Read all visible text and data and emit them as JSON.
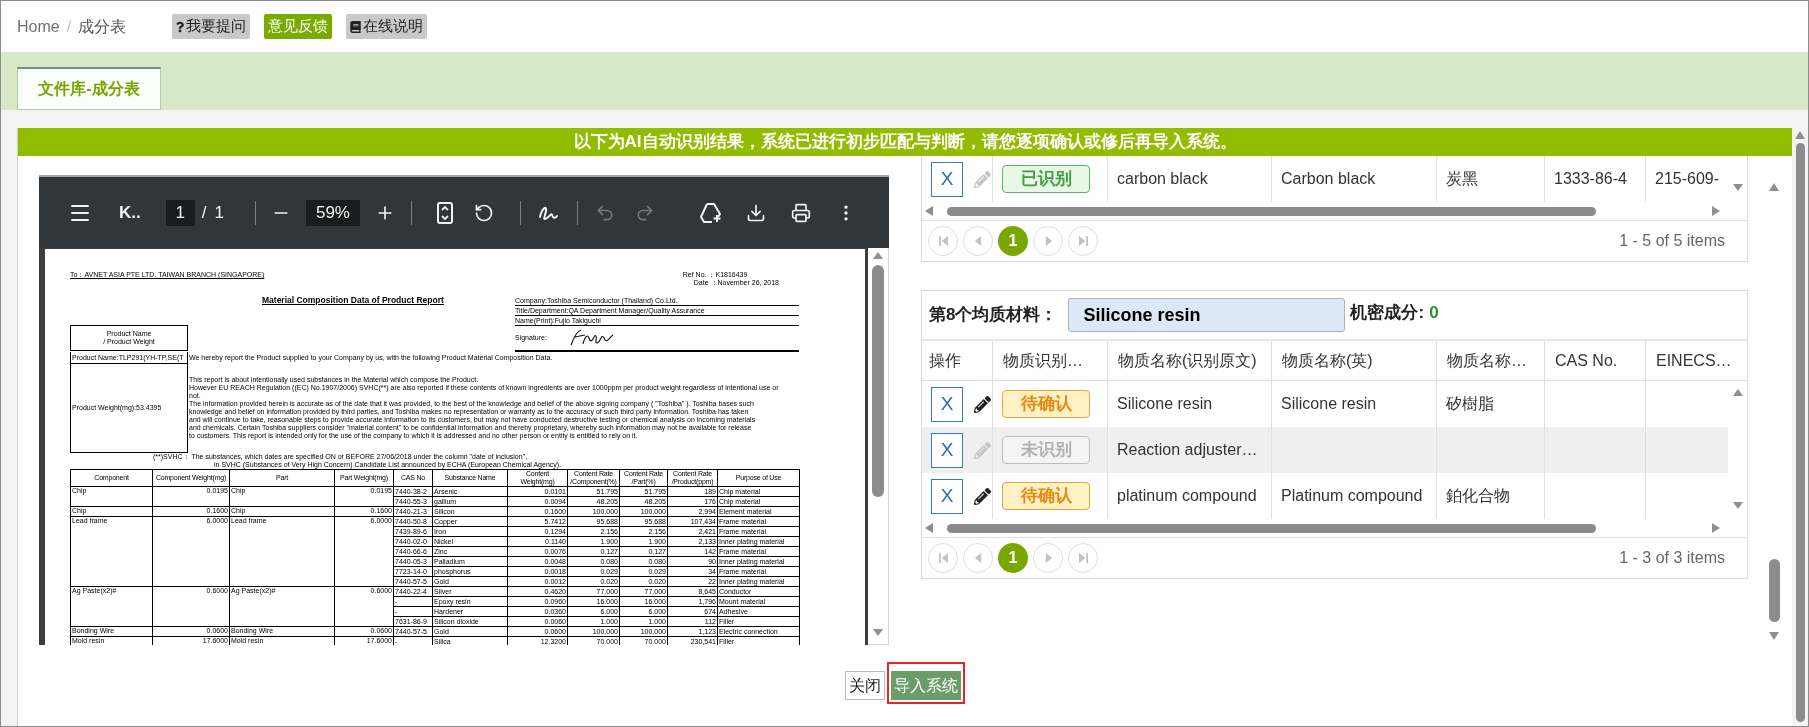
{
  "header": {
    "breadcrumb": [
      "Home",
      "成分表"
    ],
    "separator": "/",
    "buttons": [
      {
        "label": "我要提问",
        "kind": "help"
      },
      {
        "label": "意见反馈",
        "kind": "feedback"
      },
      {
        "label": "在线说明",
        "kind": "manual"
      }
    ]
  },
  "tabs": [
    {
      "label": "文件库-成分表",
      "selected": true
    }
  ],
  "banner": "以下为AI自动识别结果，系统已进行初步匹配与判断，请您逐项确认或修后再导入系统。",
  "pdf_viewer": {
    "toolbar": {
      "title": "K..",
      "page": "1",
      "page_separator": "/",
      "page_total": "1",
      "zoom": "59%",
      "undo_disabled": true,
      "redo_disabled": true
    },
    "document": {
      "recipient": "To：AVNET ASIA PTE LTD. TAIWAN BRANCH (SINGAPORE)",
      "ref_no": "Ref No. ：K1816439",
      "date": "Date ：November 26, 2018",
      "title": "Material Composition Data of Product Report",
      "signer_fields": [
        "Company:Toshiba Semiconductor (Thailand) Co.Ltd.",
        "Title/Department:QA Department Manager/Quality Assurance",
        "Name(Print):Fujio Takiguchi"
      ],
      "signature_label": "Signature:",
      "product_heading": [
        "Product Name",
        "/ Product Weight"
      ],
      "product_name": "Product Name:TLP291(YH-TP,SE(T",
      "product_weight": "Product Weight(mg):53.4395",
      "intro": "We hereby report the Product supplied to your Company by us, with the following Product Material Composition Data.",
      "notice_lines": [
        "This report is about intentionally used substances in the Material which compose the Product.",
        "However EU REACH Regulation ((EC) No.1907/2006) SVHC(**) are also reported if these contents of known ingredients are over 1000ppm per product weight regardless of intentional use or",
        "not.",
        "The information provided herein is accurate as of the date that it was provided, to the best of the knowledge and belief of the above signing company ( \"Toshiba\" ). Toshiba bases such",
        "knowledge and belief on information provided by third parties, and Toshiba makes no representation or warranty as to the accuracy of such third party information. Toshiba has taken",
        "and will continue to take, reasonable steps to provide accurate information to its customers, but may not have conducted destructive testing or chemical analysis on incoming materials",
        "and chemicals. Certain Toshiba suppliers consider \"material content\" to be confidential information and thereby proprietary, whereby such information may not be available for release",
        "to customers. This report is intended only for the use of the company to which it is addressed and no other person or entity is entitled to rely on it."
      ],
      "svhc_lines": [
        "(**)SVHC： The substances, which dates are specified ON or BEFORE 27/06/2018 under the column \"date of inclusion\",",
        "in SVHC (Substances of Very High Concern) Candidate List announced by ECHA (European Chemical Agency)."
      ],
      "table": {
        "columns": [
          [
            "Component"
          ],
          [
            "Component Weight(mg)"
          ],
          [
            "Part"
          ],
          [
            "Part Weight(mg)"
          ],
          [
            "CAS No"
          ],
          [
            "Substance Name"
          ],
          [
            "Content",
            "Weight(mg)"
          ],
          [
            "Content Rate",
            "/Component(%)"
          ],
          [
            "Content Rate",
            "/Part(%)"
          ],
          [
            "Content Rate",
            "/Product(ppm)"
          ],
          [
            "Purpose of Use"
          ]
        ],
        "groups": [
          {
            "component": "Chip",
            "component_weight": "0.0195",
            "part": "Chip",
            "part_weight": "0.0195",
            "substances": [
              [
                "7440-38-2",
                "Arsenic",
                "0.0101",
                "51.795",
                "51.795",
                "189",
                "Chip material"
              ],
              [
                "7440-55-3",
                "gallium",
                "0.0094",
                "48.205",
                "48.205",
                "176",
                "Chip material"
              ]
            ]
          },
          {
            "component": "Chip",
            "component_weight": "0.1600",
            "part": "Chip",
            "part_weight": "0.1600",
            "substances": [
              [
                "7440-21-3",
                "Silicon",
                "0.1600",
                "100.000",
                "100.000",
                "2,994",
                "Element material"
              ]
            ]
          },
          {
            "component": "Lead frame",
            "component_weight": "6.0000",
            "part": "Lead frame",
            "part_weight": "6.0000",
            "substances": [
              [
                "7440-50-8",
                "Copper",
                "5.7412",
                "95.688",
                "95.688",
                "107,434",
                "Frame material"
              ],
              [
                "7439-89-6",
                "Iron",
                "0.1294",
                "2.156",
                "2.156",
                "2,421",
                "Frame material"
              ],
              [
                "7440-02-0",
                "Nickel",
                "0.1140",
                "1.900",
                "1.900",
                "2,133",
                "Inner plating material"
              ],
              [
                "7440-66-6",
                "Zinc",
                "0.0076",
                "0.127",
                "0.127",
                "142",
                "Frame material"
              ],
              [
                "7440-05-3",
                "Palladium",
                "0.0048",
                "0.080",
                "0.080",
                "90",
                "Inner plating material"
              ],
              [
                "7723-14-0",
                "phosphorus",
                "0.0018",
                "0.029",
                "0.029",
                "34",
                "Frame material"
              ],
              [
                "7440-57-5",
                "Gold",
                "0.0012",
                "0.020",
                "0.020",
                "22",
                "Inner plating material"
              ]
            ]
          },
          {
            "component": "Ag Paste(x2)#",
            "component_weight": "0.6000",
            "part": "Ag Paste(x2)#",
            "part_weight": "0.6000",
            "substances": [
              [
                "7440-22-4",
                "Silver",
                "0.4620",
                "77.000",
                "77.000",
                "8,645",
                "Conductor"
              ],
              [
                "-",
                "Epoxy resin",
                "0.0960",
                "16.000",
                "16.000",
                "1,796",
                "Mount material"
              ],
              [
                "-",
                "Hardener",
                "0.0360",
                "6.000",
                "6.000",
                "674",
                "Adhesive"
              ],
              [
                "7631-86-9",
                "Silicon dioxide",
                "0.0060",
                "1.000",
                "1.000",
                "112",
                "Filler"
              ]
            ]
          },
          {
            "component": "Bonding Wire",
            "component_weight": "0.0600",
            "part": "Bonding Wire",
            "part_weight": "0.0600",
            "substances": [
              [
                "7440-57-5",
                "Gold",
                "0.0600",
                "100.000",
                "100.000",
                "1,123",
                "Electric connection"
              ]
            ]
          },
          {
            "component": "Mold resin",
            "component_weight": "17.6000",
            "part": "Mold resin",
            "part_weight": "17.6000",
            "substances": [
              [
                "-",
                "Silica",
                "12.3200",
                "70.000",
                "70.000",
                "230,541",
                "Filler"
              ]
            ]
          }
        ]
      }
    }
  },
  "materials": [
    {
      "rows": [
        {
          "action_label": "X",
          "editable": false,
          "kind": "recognized",
          "status_label": "已识别",
          "highlighted": false,
          "name_original": "carbon black",
          "name_en": "Carbon black",
          "name_local": "炭黑",
          "cas_no": "1333-86-4",
          "einecs": "215-609-"
        }
      ],
      "pager": {
        "nav_disabled": true,
        "pages": [
          {
            "label": "1",
            "selected": true
          }
        ],
        "summary": "1 - 5 of 5 items"
      }
    },
    {
      "title": "第8个均质材料：",
      "name_value": "Silicone resin",
      "confidential_label": "机密成分:",
      "confidential_count": "0",
      "columns": [
        "操作",
        "物质识别…",
        "物质名称(识别原文)",
        "物质名称(英)",
        "物质名称…",
        "CAS No.",
        "EINECS…"
      ],
      "rows": [
        {
          "action_label": "X",
          "editable": true,
          "kind": "pending",
          "status_label": "待确认",
          "highlighted": false,
          "name_original": "Silicone resin",
          "name_en": "Silicone resin",
          "name_local": "矽樹脂"
        },
        {
          "action_label": "X",
          "editable": false,
          "kind": "unrecognized",
          "status_label": "未识别",
          "highlighted": true,
          "name_original": "Reaction adjuster…"
        },
        {
          "action_label": "X",
          "editable": true,
          "kind": "pending",
          "status_label": "待确认",
          "highlighted": false,
          "name_original": "platinum compound",
          "name_en": "Platinum compound",
          "name_local": "鉑化合物"
        }
      ],
      "pager": {
        "nav_disabled": true,
        "pages": [
          {
            "label": "1",
            "selected": true
          }
        ],
        "summary": "1 - 3 of 3 items"
      }
    }
  ],
  "footer_buttons": [
    {
      "label": "关闭",
      "kind": "default",
      "highlighted": false
    },
    {
      "label": "导入系统",
      "kind": "primary",
      "highlighted": true
    }
  ]
}
